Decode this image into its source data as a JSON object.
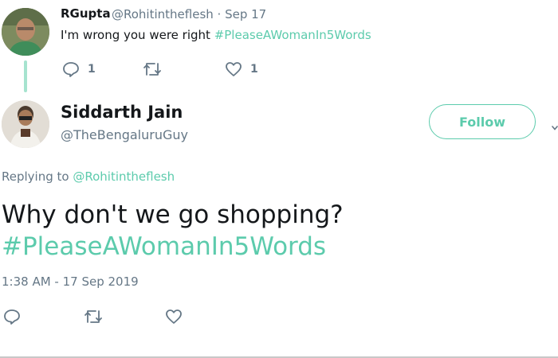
{
  "parent_tweet": {
    "author_name": "RGupta",
    "handle_date": "@Rohitintheflesh · Sep 17",
    "text": "I'm wrong you were right ",
    "hashtag": "#PleaseAWomanIn5Words",
    "actions": [
      {
        "icon": "reply-icon",
        "count": "1"
      },
      {
        "icon": "retweet-icon",
        "count": ""
      },
      {
        "icon": "like-icon",
        "count": "1"
      }
    ]
  },
  "reply_tweet": {
    "author_name": "Siddarth Jain",
    "handle": "@TheBengaluruGuy",
    "follow_label": "Follow",
    "replying_prefix": "Replying to ",
    "replying_mention": "@Rohitintheflesh",
    "text_line1": "Why don't we go shopping?",
    "text_line2": "#PleaseAWomanIn5Words",
    "timestamp": "1:38 AM - 17 Sep 2019",
    "actions": [
      {
        "icon": "reply-icon"
      },
      {
        "icon": "retweet-icon"
      },
      {
        "icon": "like-icon"
      }
    ]
  },
  "colors": {
    "accent": "#5ccbac",
    "thread_line": "#a6e3cf",
    "secondary_text": "#657786",
    "primary_text": "#14171a"
  }
}
